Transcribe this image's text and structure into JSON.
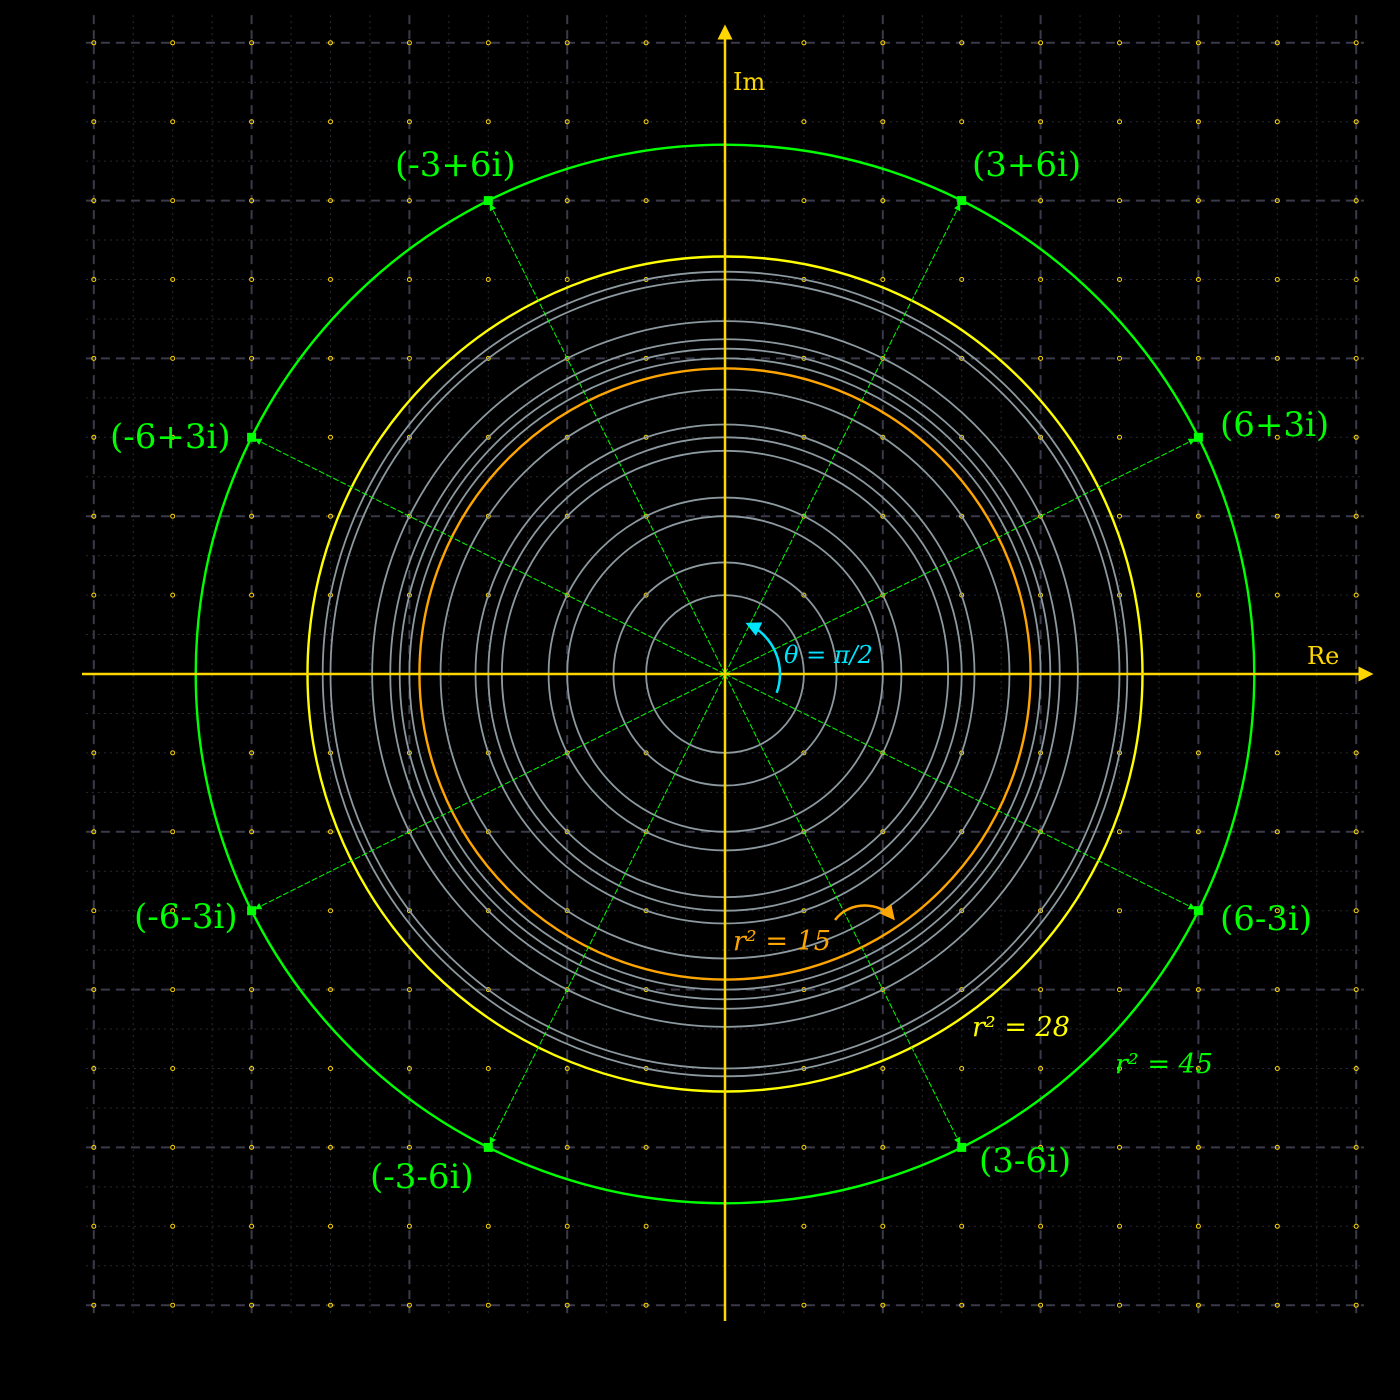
{
  "diagram": {
    "axes": {
      "x_label": "Re",
      "y_label": "Im",
      "range": [
        -8,
        8
      ]
    },
    "colors": {
      "background": "#000000",
      "axis": "#ffd700",
      "major_grid": "#3a3a4a",
      "minor_grid": "#2a2a33",
      "grid_dots": "#ffd700",
      "gray_circles": "#8c9aa0",
      "inner_circle": "#ffa500",
      "middle_circle": "#ffff00",
      "outer_circle": "#00ff00",
      "angle": "#00e5ff"
    },
    "gray_circle_r2": [
      1,
      2,
      4,
      5,
      8,
      9,
      10,
      13,
      16,
      17,
      18,
      20,
      25,
      26
    ],
    "circles": [
      {
        "r2": 15,
        "label": "r² = 15",
        "color": "#ffa500"
      },
      {
        "r2": 28,
        "label": "r² = 28",
        "color": "#ffff00"
      },
      {
        "r2": 45,
        "label": "r² = 45",
        "color": "#00ff00"
      }
    ],
    "points": [
      {
        "re": 3,
        "im": 6,
        "label": "(3+6i)"
      },
      {
        "re": -3,
        "im": 6,
        "label": "(-3+6i)"
      },
      {
        "re": -6,
        "im": 3,
        "label": "(-6+3i)"
      },
      {
        "re": 6,
        "im": 3,
        "label": "(6+3i)"
      },
      {
        "re": 6,
        "im": -3,
        "label": "(6-3i)"
      },
      {
        "re": -6,
        "im": -3,
        "label": "(-6-3i)"
      },
      {
        "re": -3,
        "im": -6,
        "label": "(-3-6i)"
      },
      {
        "re": 3,
        "im": -6,
        "label": "(3-6i)"
      }
    ],
    "angle": {
      "label": "θ = π/2",
      "from_deg": -20,
      "to_deg": 65
    }
  }
}
